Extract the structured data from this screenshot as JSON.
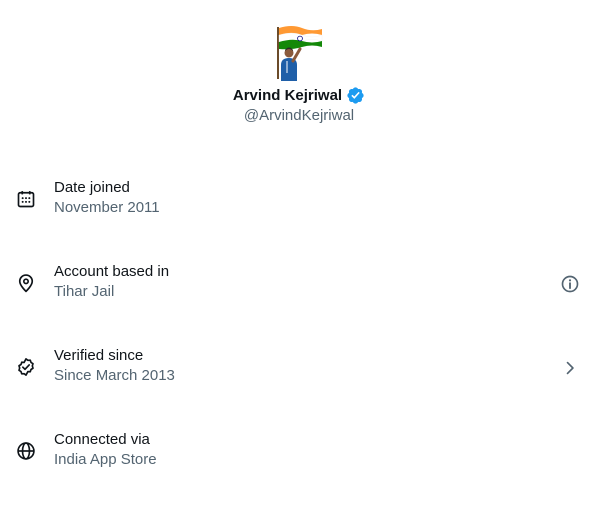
{
  "profile": {
    "name": "Arvind Kejriwal",
    "handle": "@ArvindKejriwal",
    "verified": true,
    "badge_color": "#1d9bf0"
  },
  "details": [
    {
      "icon": "calendar-icon",
      "label": "Date joined",
      "value": "November 2011",
      "trailing": null
    },
    {
      "icon": "location-pin-icon",
      "label": "Account based in",
      "value": "Tihar Jail",
      "trailing": "info-icon"
    },
    {
      "icon": "verified-check-icon",
      "label": "Verified since",
      "value": "Since March 2013",
      "trailing": "chevron-right-icon"
    },
    {
      "icon": "globe-icon",
      "label": "Connected via",
      "value": "India App Store",
      "trailing": null
    }
  ],
  "colors": {
    "text_primary": "#0f1419",
    "text_secondary": "#536471",
    "flag_saffron": "#ff9933",
    "flag_green": "#138808",
    "flag_chakra": "#000080"
  }
}
